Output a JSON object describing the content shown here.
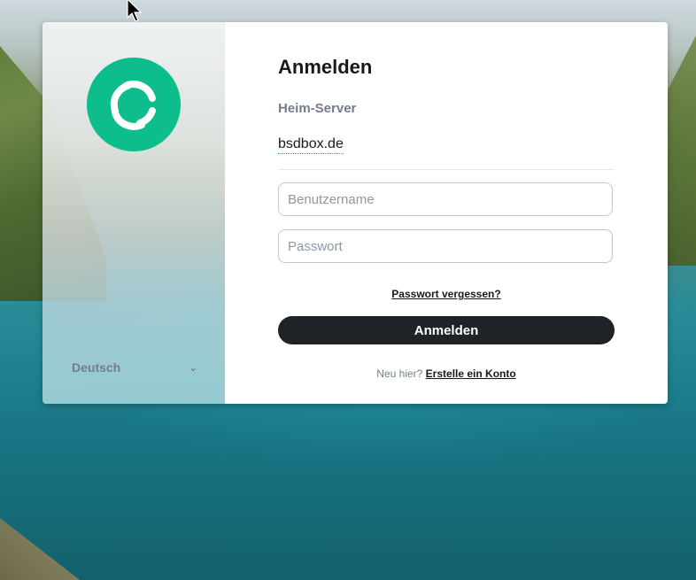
{
  "login": {
    "title": "Anmelden",
    "homeserver_label": "Heim-Server",
    "homeserver_value": "bsdbox.de",
    "username_placeholder": "Benutzername",
    "password_placeholder": "Passwort",
    "forgot_password": "Passwort vergessen?",
    "submit_label": "Anmelden",
    "new_here": "Neu hier?",
    "create_account": "Erstelle ein Konto"
  },
  "sidebar": {
    "language": "Deutsch",
    "language_icon": "chevron-down-icon"
  },
  "colors": {
    "brand": "#0dbd8b",
    "button": "#1f2226",
    "muted": "#737d8c"
  }
}
